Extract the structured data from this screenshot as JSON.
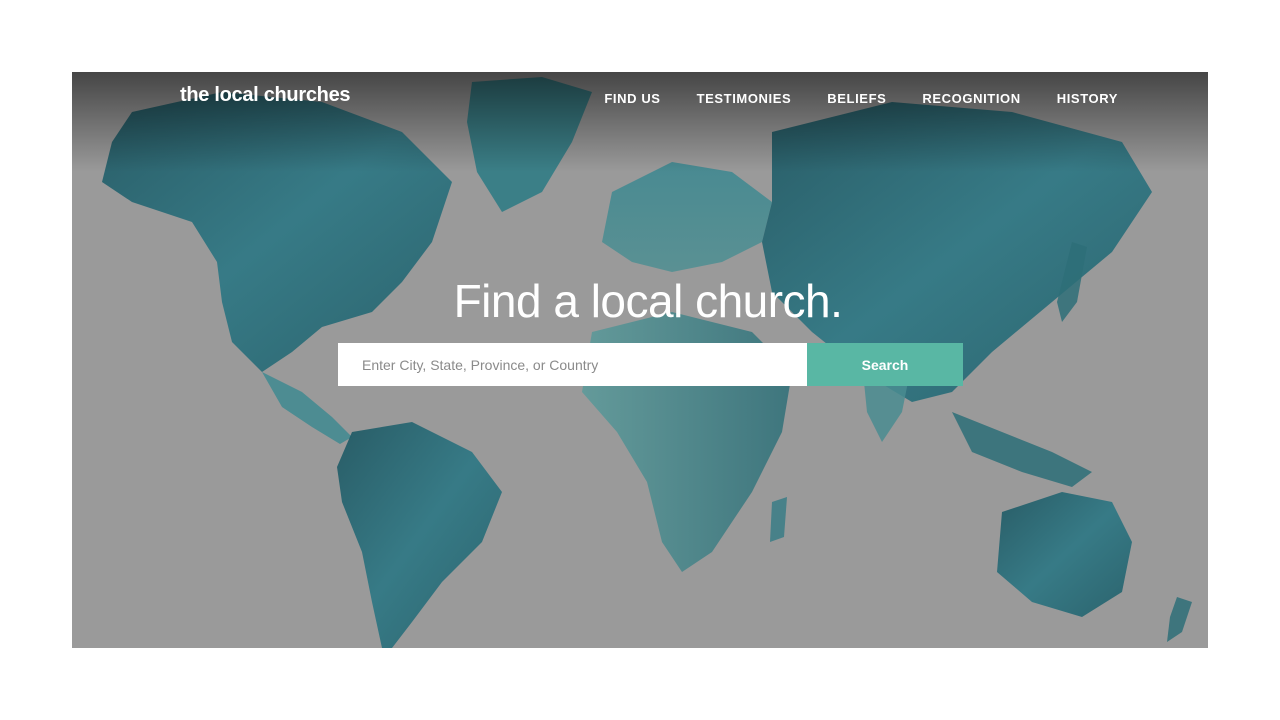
{
  "header": {
    "logo_text": "the local churches",
    "nav": [
      {
        "label": "FIND US"
      },
      {
        "label": "TESTIMONIES"
      },
      {
        "label": "BELIEFS"
      },
      {
        "label": "RECOGNITION"
      },
      {
        "label": "HISTORY"
      }
    ]
  },
  "hero": {
    "headline": "Find a local church.",
    "search": {
      "placeholder": "Enter City, State, Province, or Country",
      "value": "",
      "button_label": "Search"
    }
  },
  "colors": {
    "accent": "#59b7a4",
    "background": "#9a9a9a",
    "map_teal": "#2a6f7a"
  }
}
